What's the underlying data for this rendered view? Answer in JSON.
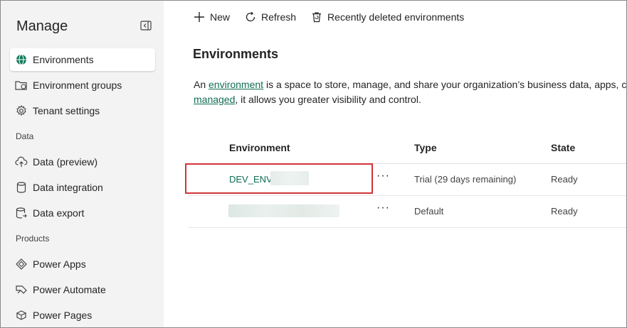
{
  "sidebar": {
    "title": "Manage",
    "items_top": [
      {
        "label": "Environments",
        "icon": "globe-icon",
        "active": true
      },
      {
        "label": "Environment groups",
        "icon": "environment-groups-icon"
      },
      {
        "label": "Tenant settings",
        "icon": "gear-icon"
      }
    ],
    "section_data": "Data",
    "items_data": [
      {
        "label": "Data (preview)",
        "icon": "cloud-upload-icon"
      },
      {
        "label": "Data integration",
        "icon": "database-icon"
      },
      {
        "label": "Data export",
        "icon": "database-export-icon"
      }
    ],
    "section_products": "Products",
    "items_products": [
      {
        "label": "Power Apps",
        "icon": "power-apps-icon"
      },
      {
        "label": "Power Automate",
        "icon": "power-automate-icon"
      },
      {
        "label": "Power Pages",
        "icon": "power-pages-icon"
      }
    ]
  },
  "commandbar": {
    "new": "New",
    "refresh": "Refresh",
    "recently_deleted": "Recently deleted environments"
  },
  "page": {
    "title": "Environments",
    "desc_line1_pre": "An ",
    "desc_link1": "environment",
    "desc_line1_post": " is a space to store, manage, and share your organization’s business data, apps, cha",
    "desc_link2": "managed",
    "desc_line2_post": ", it allows you greater visibility and control."
  },
  "table": {
    "headers": {
      "environment": "Environment",
      "type": "Type",
      "state": "State"
    },
    "rows": [
      {
        "name": "DEV_ENV_",
        "more": "···",
        "type": "Trial (29 days remaining)",
        "state": "Ready"
      },
      {
        "name": "",
        "more": "···",
        "type": "Default",
        "state": "Ready"
      }
    ]
  },
  "colors": {
    "accent_link": "#0f6e52",
    "highlight_box": "#d13438",
    "sidebar_bg": "#f3f3f3"
  }
}
